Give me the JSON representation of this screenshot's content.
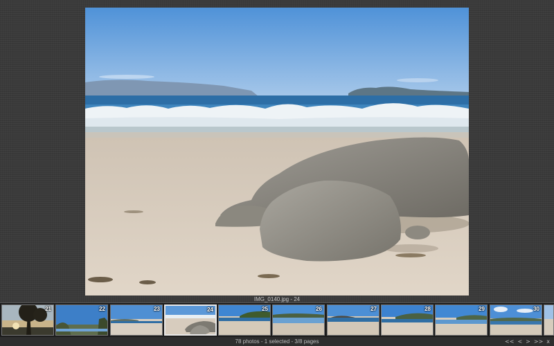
{
  "viewer": {
    "caption": "IMG_0140.jpg - 24"
  },
  "filmstrip": {
    "thumbnails": [
      {
        "number": "21",
        "scene": "sunset-trees",
        "selected": false
      },
      {
        "number": "22",
        "scene": "trees-water",
        "selected": false
      },
      {
        "number": "23",
        "scene": "beach-island",
        "selected": false
      },
      {
        "number": "24",
        "scene": "beach-rocks",
        "selected": true
      },
      {
        "number": "25",
        "scene": "beach-green-hill",
        "selected": false
      },
      {
        "number": "26",
        "scene": "beach-wide",
        "selected": false
      },
      {
        "number": "27",
        "scene": "beach-rock-point",
        "selected": false
      },
      {
        "number": "28",
        "scene": "beach-hill",
        "selected": false
      },
      {
        "number": "29",
        "scene": "beach-calm",
        "selected": false
      },
      {
        "number": "30",
        "scene": "beach-clouds",
        "selected": false
      }
    ]
  },
  "status": {
    "text": "78 photos - 1 selected - 3/8 pages"
  },
  "navigation": {
    "first": "<<",
    "prev": "<",
    "next": ">",
    "last": ">>",
    "close": "x"
  },
  "colors": {
    "background": "#3a3a3a",
    "sky": "#6aa3dd",
    "sand": "#d8cdbf",
    "sea": "#2e6fa6",
    "rock": "#8a877f"
  }
}
